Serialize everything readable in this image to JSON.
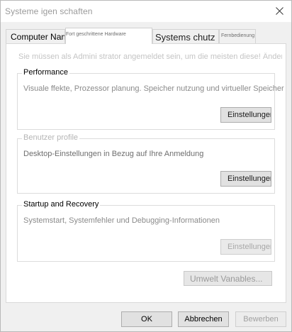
{
  "window": {
    "title": "Systeme igen schaften",
    "close_icon": "close-icon"
  },
  "tabs": [
    {
      "label": "Computer Name"
    },
    {
      "label": "Fort geschrittene Hardware"
    },
    {
      "label": "Systems chutz"
    },
    {
      "label": "Fernbedienung"
    }
  ],
  "notice": "Sie müssen als Admini strator angemeldet sein, um die meisten diese! Änderungen",
  "groups": {
    "performance": {
      "title": "Performance",
      "description": "Visuale ffekte, Prozessor planung. Speicher nutzung und virtueller Speicher",
      "button": "Einstellungen..."
    },
    "user_profiles": {
      "title": "Benutzer profile",
      "description": "Desktop-Einstellungen in Bezug auf Ihre Anmeldung",
      "button": "Einstellungen..."
    },
    "startup_recovery": {
      "title": "Startup and Recovery",
      "description": "Systemstart, Systemfehler und Debugging-Informationen",
      "button": "Einstellungen..."
    }
  },
  "env_button": "Umwelt Vanables...",
  "footer": {
    "ok": "OK",
    "cancel": "Abbrechen",
    "apply": "Bewerben"
  }
}
